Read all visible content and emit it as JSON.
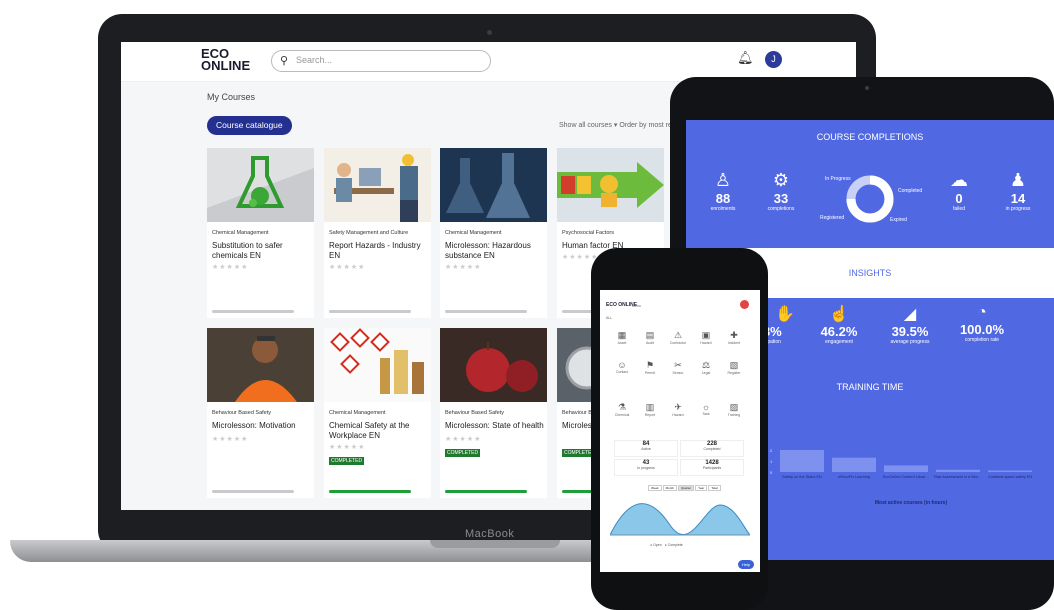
{
  "laptop": {
    "brand_label": "MacBook",
    "header": {
      "logo_top": "ECO",
      "logo_bottom": "ONLINE",
      "search_placeholder": "Search...",
      "avatar_initial": "J"
    },
    "page_title": "My Courses",
    "catalogue_button": "Course catalogue",
    "sort_text": "Show all courses  ▾   Order by most re",
    "cards": [
      {
        "category": "Chemical Management",
        "title": "Substitution to safer chemicals EN",
        "completed": false
      },
      {
        "category": "Safety Management and Culture",
        "title": "Report Hazards - Industry EN",
        "completed": false
      },
      {
        "category": "Chemical Management",
        "title": "Microlesson: Hazardous substance EN",
        "completed": false
      },
      {
        "category": "Psychosocial Factors",
        "title": "Human factor EN",
        "completed": false
      },
      {
        "category": "Behaviour Based Safety",
        "title": "Microlesson: Motivation",
        "completed": false
      },
      {
        "category": "Chemical Management",
        "title": "Chemical Safety at the Workplace EN",
        "completed": true
      },
      {
        "category": "Behaviour Based Safety",
        "title": "Microlesson: State of health",
        "completed": true
      },
      {
        "category": "Behaviour Bas",
        "title": "Microles",
        "completed": true
      }
    ],
    "completed_badge": "COMPLETED",
    "stars": "★★★★★"
  },
  "tablet": {
    "course_completions_title": "COURSE COMPLETIONS",
    "stats": [
      {
        "value": "88",
        "label": "enrolments"
      },
      {
        "value": "33",
        "label": "completions"
      },
      {
        "value": "0",
        "label": "failed"
      },
      {
        "value": "14",
        "label": "in progress"
      }
    ],
    "donut_labels": {
      "in_progress": "In Progress",
      "completed": "Completed",
      "registered": "Registered",
      "expired": "Expired"
    },
    "insights_title": "INSIGHTS",
    "insights": [
      {
        "value": "0.8%",
        "label": "participation"
      },
      {
        "value": "46.2%",
        "label": "engagement"
      },
      {
        "value": "39.5%",
        "label": "average progress"
      },
      {
        "value": "100.0%",
        "label": "completion rate"
      }
    ],
    "training_time_title": "TRAINING TIME",
    "chart_labels": [
      "Safety on the Stairs EN",
      "eRenzFix Learning",
      "EcoOnline Content Library UK and Ireland (English)",
      "Risk Assessment in a Workplace UK",
      "Confined space safety EN"
    ],
    "chart_values": [
      1.0,
      0.65,
      0.3,
      0.1,
      0.05
    ],
    "chart_axis": [
      "2",
      "1",
      "0"
    ],
    "chart_caption": "Most active courses (in hours)",
    "colors": {
      "accent": "#5168e3",
      "bar": "#7f91ee"
    }
  },
  "phone": {
    "logo": "ECO ONLINE",
    "menu_label": "Menu",
    "section_label": "ALL",
    "icons_row1": [
      "Asset",
      "Audit",
      "Contractor",
      "Hazard",
      "Incident"
    ],
    "icons_row2": [
      "Contact",
      "Permit",
      "Sensor",
      "Legal",
      "Register"
    ],
    "icons_row3": [
      "Chemical",
      "Report",
      "Hazard",
      "Task",
      "Training"
    ],
    "kpis": [
      {
        "value": "84",
        "label": "Active"
      },
      {
        "value": "228",
        "label": "Completed"
      },
      {
        "value": "43",
        "label": "In progress"
      },
      {
        "value": "1428",
        "label": "Participants"
      }
    ],
    "tabs": [
      "Week",
      "Month",
      "Quarter",
      "Year",
      "Total"
    ],
    "legend": [
      "Open",
      "Complete"
    ],
    "help": "Help"
  }
}
